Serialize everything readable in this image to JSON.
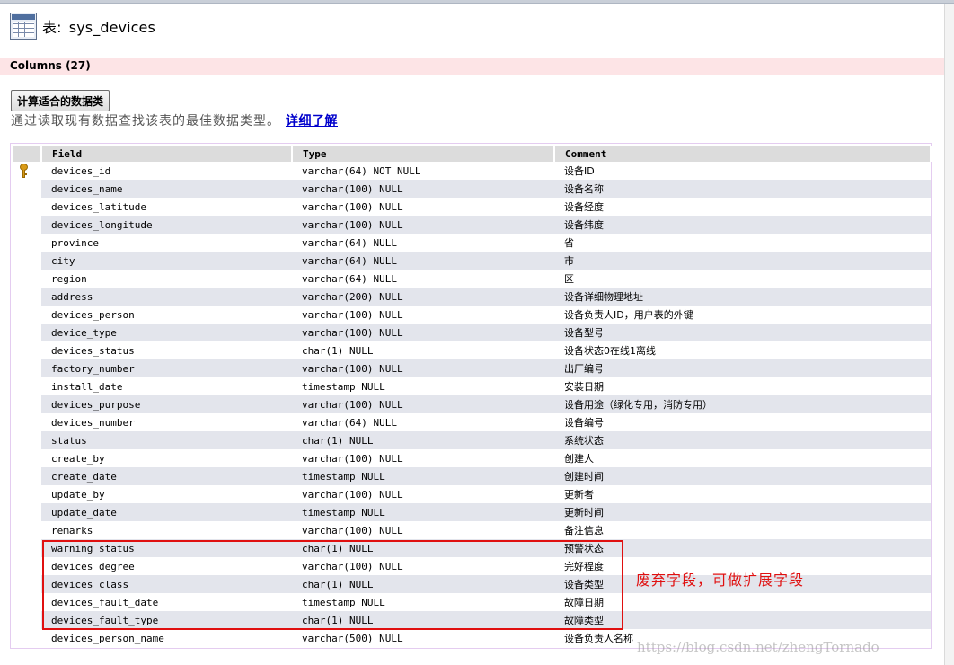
{
  "page": {
    "title_prefix": "表:",
    "table_name": "sys_devices",
    "columns_label": "Columns (27)",
    "calc_button_label": "计算适合的数据类",
    "hint_text": "通过读取现有数据查找该表的最佳数据类型。",
    "learn_more_link": "详细了解"
  },
  "table": {
    "headers": {
      "field": "Field",
      "type": "Type",
      "comment": "Comment"
    },
    "rows": [
      {
        "field": "devices_id",
        "type": "varchar(64) NOT NULL",
        "comment": "设备ID",
        "primary_key": true
      },
      {
        "field": "devices_name",
        "type": "varchar(100) NULL",
        "comment": "设备名称"
      },
      {
        "field": "devices_latitude",
        "type": "varchar(100) NULL",
        "comment": "设备经度"
      },
      {
        "field": "devices_longitude",
        "type": "varchar(100) NULL",
        "comment": "设备纬度"
      },
      {
        "field": "province",
        "type": "varchar(64) NULL",
        "comment": "省"
      },
      {
        "field": "city",
        "type": "varchar(64) NULL",
        "comment": "市"
      },
      {
        "field": "region",
        "type": "varchar(64) NULL",
        "comment": "区"
      },
      {
        "field": "address",
        "type": "varchar(200) NULL",
        "comment": "设备详细物理地址"
      },
      {
        "field": "devices_person",
        "type": "varchar(100) NULL",
        "comment": "设备负责人ID，用户表的外键"
      },
      {
        "field": "device_type",
        "type": "varchar(100) NULL",
        "comment": "设备型号"
      },
      {
        "field": "devices_status",
        "type": "char(1) NULL",
        "comment": "设备状态0在线1离线"
      },
      {
        "field": "factory_number",
        "type": "varchar(100) NULL",
        "comment": "出厂编号"
      },
      {
        "field": "install_date",
        "type": "timestamp NULL",
        "comment": "安装日期"
      },
      {
        "field": "devices_purpose",
        "type": "varchar(100) NULL",
        "comment": "设备用途（绿化专用，消防专用）"
      },
      {
        "field": "devices_number",
        "type": "varchar(64) NULL",
        "comment": "设备编号"
      },
      {
        "field": "status",
        "type": "char(1) NULL",
        "comment": "系统状态"
      },
      {
        "field": "create_by",
        "type": "varchar(100) NULL",
        "comment": "创建人"
      },
      {
        "field": "create_date",
        "type": "timestamp NULL",
        "comment": "创建时间"
      },
      {
        "field": "update_by",
        "type": "varchar(100) NULL",
        "comment": "更新者"
      },
      {
        "field": "update_date",
        "type": "timestamp NULL",
        "comment": "更新时间"
      },
      {
        "field": "remarks",
        "type": "varchar(100) NULL",
        "comment": "备注信息"
      },
      {
        "field": "warning_status",
        "type": "char(1) NULL",
        "comment": "预警状态"
      },
      {
        "field": "devices_degree",
        "type": "varchar(100) NULL",
        "comment": "完好程度"
      },
      {
        "field": "devices_class",
        "type": "char(1) NULL",
        "comment": "设备类型"
      },
      {
        "field": "devices_fault_date",
        "type": "timestamp NULL",
        "comment": "故障日期"
      },
      {
        "field": "devices_fault_type",
        "type": "char(1) NULL",
        "comment": "故障类型"
      },
      {
        "field": "devices_person_name",
        "type": "varchar(500) NULL",
        "comment": "设备负责人名称"
      }
    ]
  },
  "annotation": {
    "text": "废弃字段，可做扩展字段",
    "color": "#e01010"
  },
  "watermark": "https://blog.csdn.net/zhengTornado",
  "colors": {
    "columns_bar": "#fde4e6",
    "header_row": "#dcdcdc",
    "alt_row": "#e3e5ec",
    "link": "#0000cc",
    "key_icon": "#d99a16"
  }
}
